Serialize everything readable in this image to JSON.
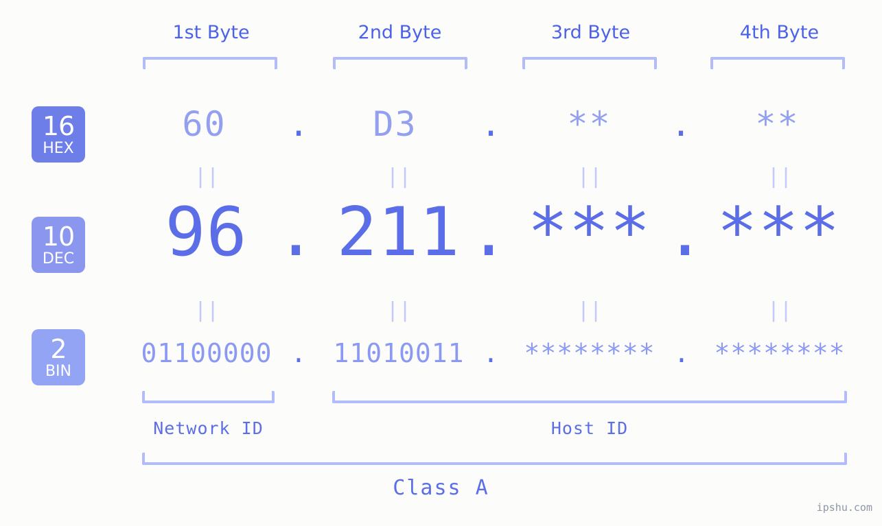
{
  "watermark": "ipshu.com",
  "colors": {
    "background": "#fcfdfa",
    "accent_strong": "#5b6ee8",
    "accent_header": "#4c62e8",
    "accent_mid": "#93a0f0",
    "accent_light": "#b3bcfa",
    "accent_faint": "#c3caf9",
    "badge_hex": "#6e7ee8",
    "badge_dec": "#8b97ef",
    "badge_bin": "#93a4f5"
  },
  "byte_headers": [
    {
      "label": "1st Byte"
    },
    {
      "label": "2nd Byte"
    },
    {
      "label": "3rd Byte"
    },
    {
      "label": "4th Byte"
    }
  ],
  "bases": [
    {
      "number": "16",
      "abbr": "HEX"
    },
    {
      "number": "10",
      "abbr": "DEC"
    },
    {
      "number": "2",
      "abbr": "BIN"
    }
  ],
  "rows": {
    "hex": {
      "values": [
        "60",
        "D3",
        "**",
        "**"
      ],
      "separator": "."
    },
    "dec": {
      "values": [
        "96",
        "211",
        "***",
        "***"
      ],
      "separator": "."
    },
    "bin": {
      "values": [
        "01100000",
        "11010011",
        "********",
        "********"
      ],
      "separator": "."
    }
  },
  "equality_marker": "||",
  "id_sections": [
    {
      "label": "Network ID"
    },
    {
      "label": "Host ID"
    }
  ],
  "class": {
    "label": "Class A"
  }
}
